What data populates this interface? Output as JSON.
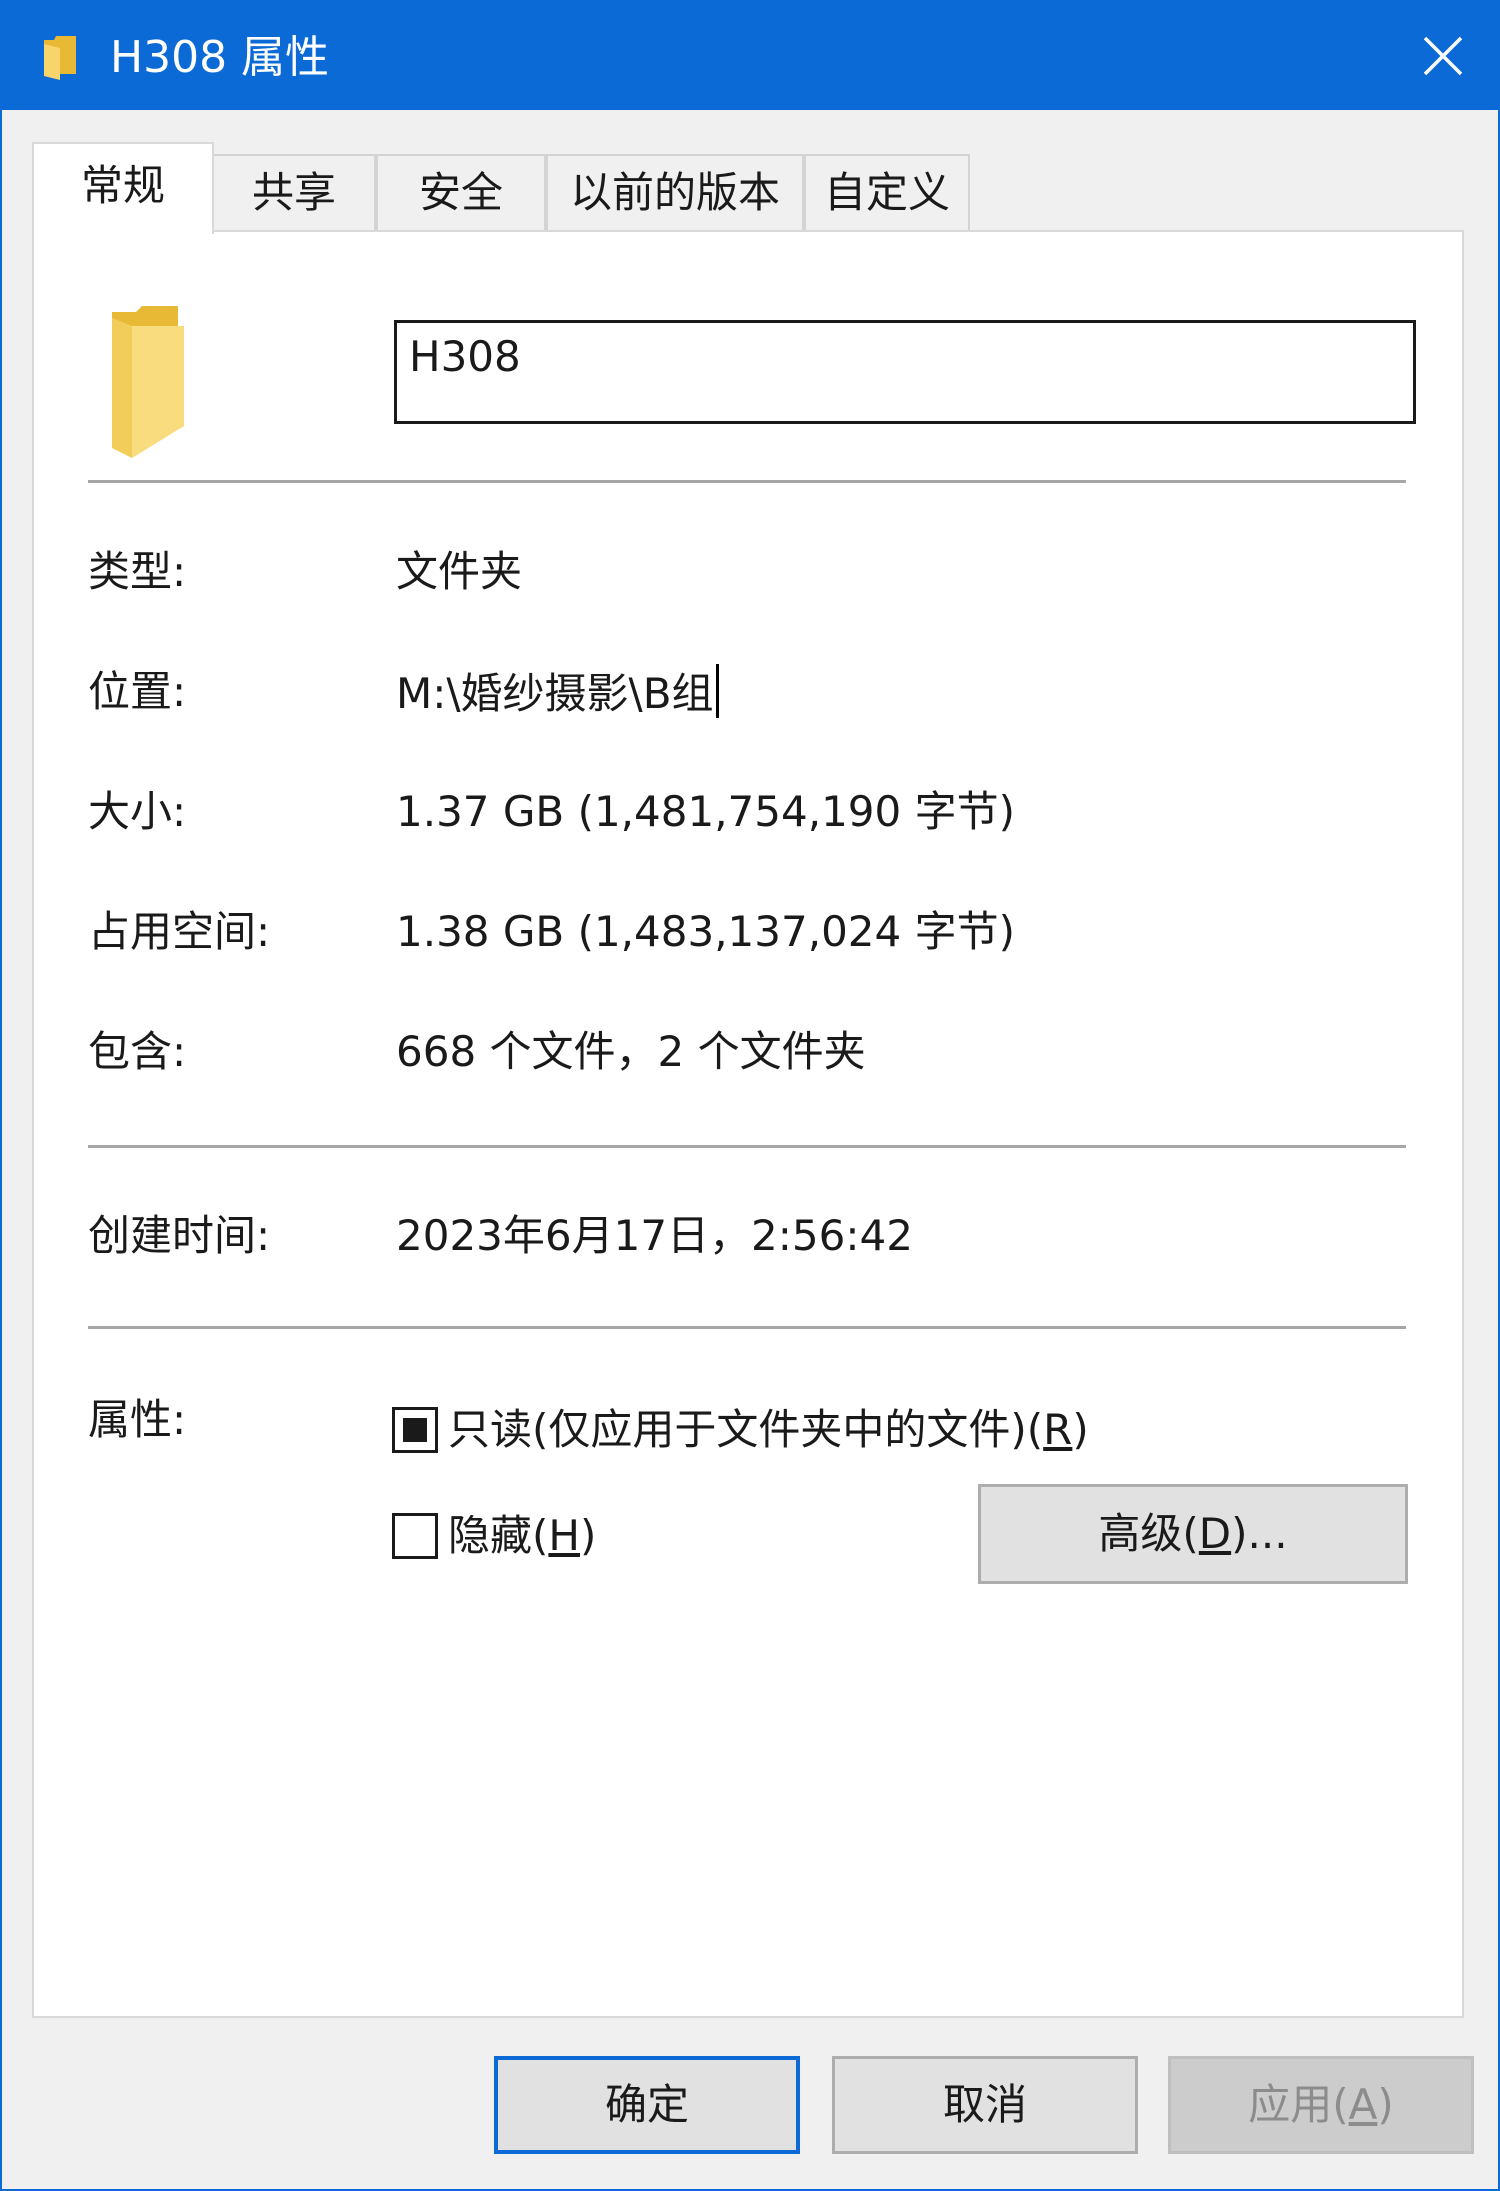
{
  "window": {
    "title": "H308 属性",
    "close_glyph": "✕",
    "accent_color": "#0b6ad6"
  },
  "tabs": [
    {
      "label": "常规",
      "active": true
    },
    {
      "label": "共享",
      "active": false
    },
    {
      "label": "安全",
      "active": false
    },
    {
      "label": "以前的版本",
      "active": false
    },
    {
      "label": "自定义",
      "active": false
    }
  ],
  "general": {
    "folder_icon": "folder-icon",
    "name_value": "H308",
    "type_label": "类型:",
    "type_value": "文件夹",
    "location_label": "位置:",
    "location_value": "M:\\婚纱摄影\\B组",
    "size_label": "大小:",
    "size_value": "1.37 GB (1,481,754,190 字节)",
    "disk_size_label": "占用空间:",
    "disk_size_value": "1.38 GB (1,483,137,024 字节)",
    "contains_label": "包含:",
    "contains_value": "668 个文件，2 个文件夹",
    "created_label": "创建时间:",
    "created_value": "2023年6月17日，2:56:42",
    "attributes_label": "属性:",
    "readonly_text": "只读(仅应用于文件夹中的文件)(",
    "readonly_key": "R",
    "readonly_close": ")",
    "readonly_state": "indeterminate",
    "hidden_text": "隐藏(",
    "hidden_key": "H",
    "hidden_close": ")",
    "hidden_checked": false,
    "advanced_text": "高级(",
    "advanced_key": "D",
    "advanced_close": ")..."
  },
  "footer": {
    "ok_label": "确定",
    "cancel_label": "取消",
    "apply_text": "应用(",
    "apply_key": "A",
    "apply_close": ")",
    "apply_enabled": false
  }
}
